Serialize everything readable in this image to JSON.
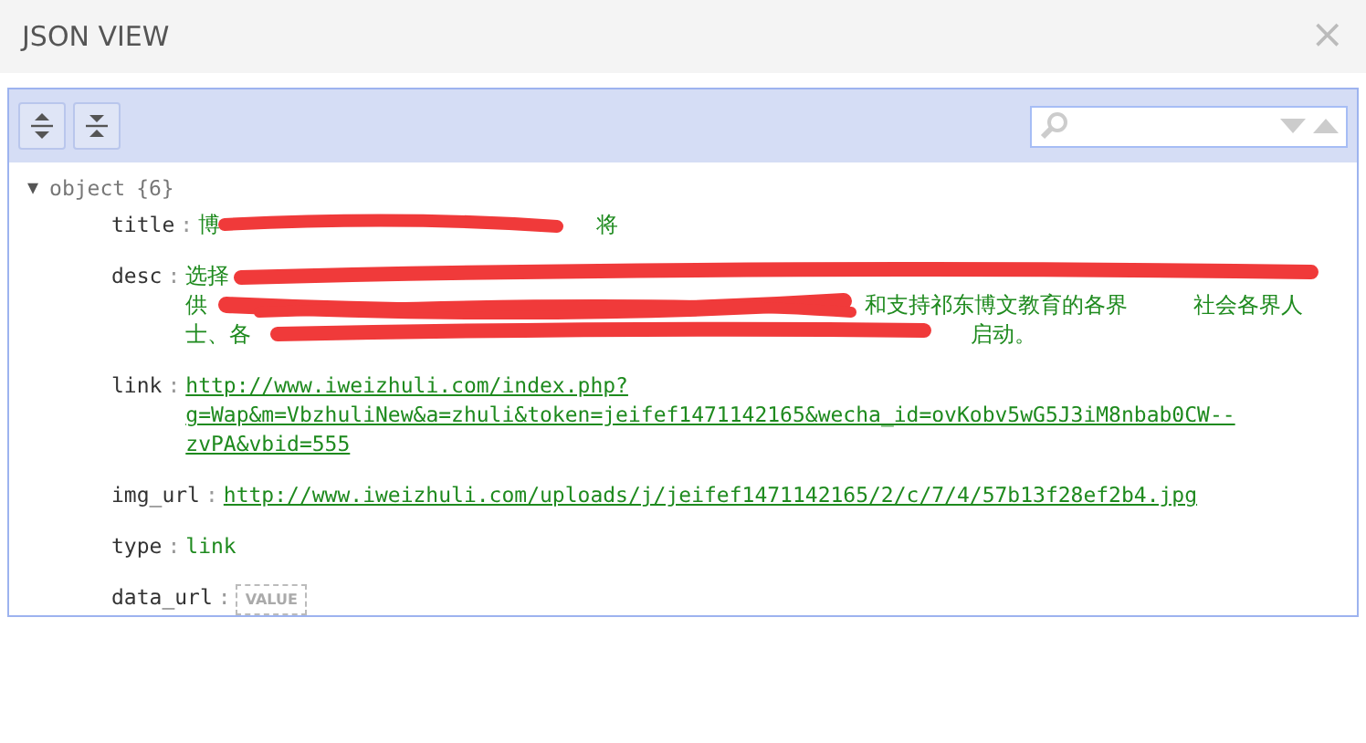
{
  "window": {
    "title": "JSON VIEW",
    "close": "×"
  },
  "toolbar": {
    "buttons": [
      {
        "kind": "expand"
      },
      {
        "kind": "collapse"
      }
    ]
  },
  "root": {
    "toggle": "▼",
    "label": "object",
    "count": "{6}",
    "expanded": true
  },
  "fields": [
    {
      "key": "title",
      "colon": ":",
      "kind": "redacted",
      "lines": [
        [
          "博",
          "将"
        ]
      ]
    },
    {
      "key": "desc",
      "colon": ":",
      "kind": "redacted",
      "lines": [
        [
          "选择"
        ],
        [
          "供",
          "和支持祁东博文教育的各界",
          "社会各界人"
        ],
        [
          "士、各",
          "启动。"
        ]
      ]
    },
    {
      "key": "link",
      "colon": ":",
      "kind": "url",
      "value": "http://www.iweizhuli.com/index.php?g=Wap&m=VbzhuliNew&a=zhuli&token=jeifef1471142165&wecha_id=ovKobv5wG5J3iM8nbab0CW--zvPA&vbid=555"
    },
    {
      "key": "img_url",
      "colon": ":",
      "kind": "url",
      "value": "http://www.iweizhuli.com/uploads/j/jeifef1471142165/2/c/7/4/57b13f28ef2b4.jpg"
    },
    {
      "key": "type",
      "colon": ":",
      "kind": "string",
      "value": "link"
    },
    {
      "key": "data_url",
      "colon": ":",
      "kind": "empty",
      "placeholder": "VALUE"
    }
  ]
}
